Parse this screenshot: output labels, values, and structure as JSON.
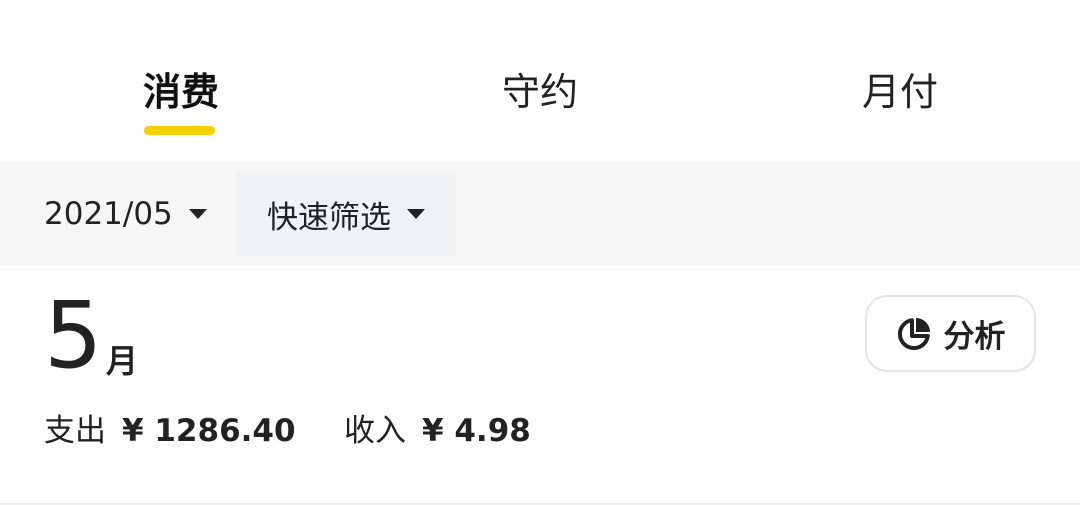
{
  "tabs": [
    {
      "label": "消费",
      "active": true
    },
    {
      "label": "守约",
      "active": false
    },
    {
      "label": "月付",
      "active": false
    }
  ],
  "filter_bar": {
    "date_value": "2021/05",
    "quick_filter_label": "快速筛选"
  },
  "month_header": {
    "month_number": "5",
    "month_unit": "月",
    "analysis_button_label": "分析",
    "analysis_icon": "pie-chart-icon"
  },
  "summary": {
    "expense_label": "支出",
    "expense_amount": "¥ 1286.40",
    "income_label": "收入",
    "income_amount": "¥ 4.98"
  },
  "colors": {
    "accent": "#F5D000",
    "filter_bar_bg": "#F6F6F6",
    "text": "#222222"
  }
}
